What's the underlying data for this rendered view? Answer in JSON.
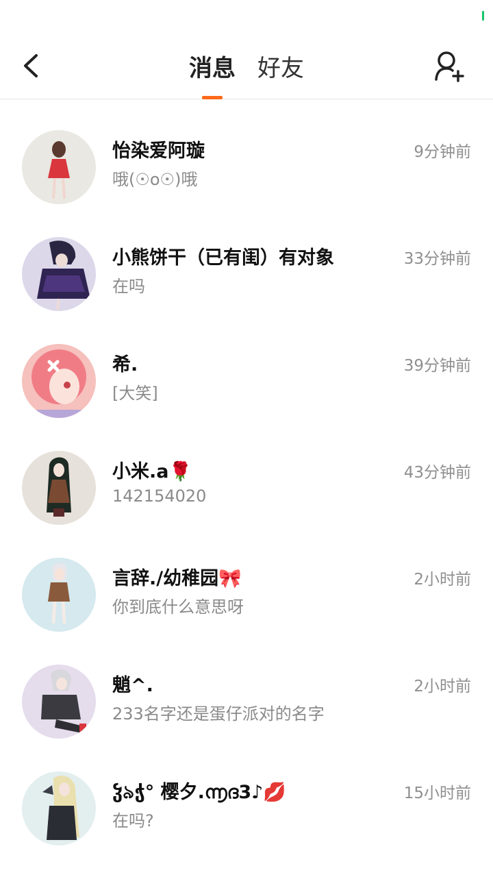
{
  "header": {
    "tabs": [
      {
        "label": "消息",
        "active": true
      },
      {
        "label": "好友",
        "active": false
      }
    ],
    "accent_color": "#ff6a1a"
  },
  "conversations": [
    {
      "name": "怡染爱阿璇",
      "preview": "哦(☉o☉)哦",
      "time": "9分钟前",
      "avatar_color": "#e9e8e2"
    },
    {
      "name": "小熊饼干（已有闺）有对象",
      "preview": "在吗",
      "time": "33分钟前",
      "avatar_color": "#dcd8ea"
    },
    {
      "name": "希.",
      "preview": "[大笑]",
      "time": "39分钟前",
      "avatar_color": "#f6c0bd"
    },
    {
      "name": "小米.a🌹",
      "preview": "142154020",
      "time": "43分钟前",
      "avatar_color": "#e6e1da"
    },
    {
      "name": "言辞./幼稚园🎀",
      "preview": "你到底什么意思呀",
      "time": "2小时前",
      "avatar_color": "#d5e9ee"
    },
    {
      "name": "魈^.",
      "preview": "233名字还是蛋仔派对的名字",
      "time": "2小时前",
      "avatar_color": "#e5dcec"
    },
    {
      "name": "ჴ৯ჭ° 樱夕.൬ദ3♪💋",
      "preview": "在吗?",
      "time": "15小时前",
      "avatar_color": "#e3eeee"
    }
  ]
}
